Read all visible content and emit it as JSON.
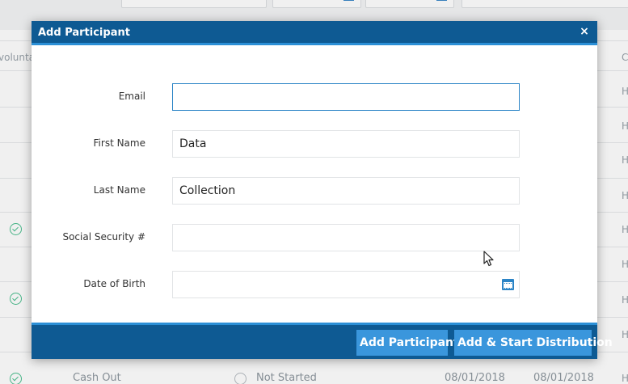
{
  "background": {
    "column_header_partial": "volunta",
    "row_h_marker": "H",
    "row_h_marker_partial": "C",
    "bottom_row": {
      "type": "Cash Out",
      "status": "Not Started",
      "date1": "08/01/2018",
      "date2": "08/01/2018"
    }
  },
  "modal": {
    "title": "Add Participant",
    "close_icon": "×",
    "fields": {
      "email": {
        "label": "Email",
        "value": ""
      },
      "first_name": {
        "label": "First Name",
        "value": "Data"
      },
      "last_name": {
        "label": "Last Name",
        "value": "Collection"
      },
      "ssn": {
        "label": "Social Security #",
        "value": ""
      },
      "dob": {
        "label": "Date of Birth",
        "value": "",
        "icon": "calendar-icon"
      }
    },
    "buttons": {
      "add": "Add Participant",
      "add_start": "Add & Start Distribution"
    }
  },
  "colors": {
    "header": "#0e5a93",
    "header_accent": "#2b8fd6",
    "button": "#3a96dc",
    "focus": "#2b84c6",
    "check": "#4cbf8f"
  }
}
